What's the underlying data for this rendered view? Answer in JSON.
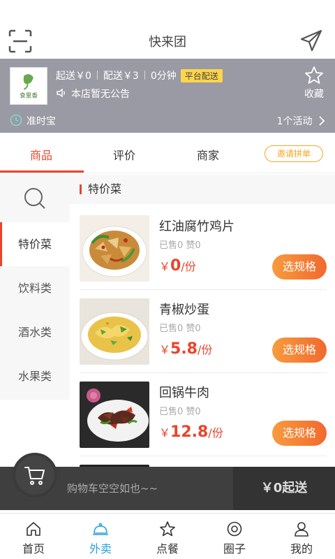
{
  "header": {
    "title": "快来团",
    "scan_icon": "scan-icon",
    "share_icon": "send-icon"
  },
  "store": {
    "min_order": "起送￥0",
    "delivery_fee": "配送￥3",
    "delivery_time": "0分钟",
    "platform_badge": "平台配送",
    "notice": "本店暂无公告",
    "favorite_label": "收藏",
    "timely": "准时宝",
    "activity": "1个活动",
    "logo_text": "食里香"
  },
  "tabs": {
    "items": [
      "商品",
      "评价",
      "商家"
    ],
    "active": "商品",
    "invite": "邀请拼单"
  },
  "categories": [
    "特价菜",
    "饮料类",
    "酒水类",
    "水果类"
  ],
  "section": {
    "title": "特价菜"
  },
  "items": [
    {
      "name": "红油腐竹鸡片",
      "stats": "已售0 赞0",
      "currency": "￥",
      "price": "0",
      "unit": "/份",
      "button": "选规格"
    },
    {
      "name": "青椒炒蛋",
      "stats": "已售0 赞0",
      "currency": "￥",
      "price": "5.8",
      "unit": "/份",
      "button": "选规格"
    },
    {
      "name": "回锅牛肉",
      "stats": "已售0 赞0",
      "currency": "￥",
      "price": "12.8",
      "unit": "/份",
      "button": "选规格"
    }
  ],
  "cart": {
    "empty_text": "购物车空空如也~~",
    "checkout": "￥0起送"
  },
  "bottom_nav": [
    {
      "label": "首页",
      "icon": "home-icon"
    },
    {
      "label": "外卖",
      "icon": "cloche-icon"
    },
    {
      "label": "点餐",
      "icon": "star-icon"
    },
    {
      "label": "圈子",
      "icon": "circle-icon"
    },
    {
      "label": "我的",
      "icon": "user-icon"
    }
  ],
  "colors": {
    "accent": "#e8452c",
    "store_bar": "#9a9aa4",
    "badge": "#ffd54a",
    "nav_active": "#2a9fd8",
    "button_gradient_start": "#f79b3e",
    "button_gradient_end": "#f2692e"
  }
}
